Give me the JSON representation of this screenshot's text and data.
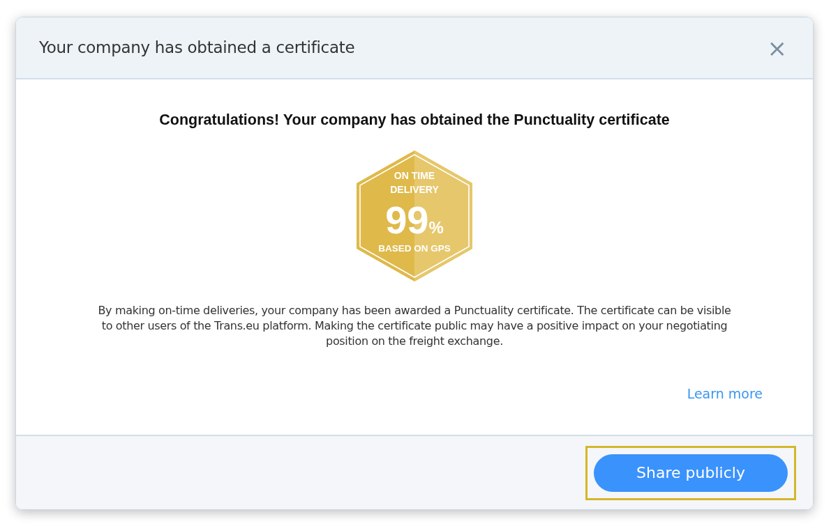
{
  "dialog": {
    "title": "Your company has obtained a certificate",
    "close": "×"
  },
  "heading": "Congratulations! Your company has obtained the Punctuality certificate",
  "badge": {
    "line_1": "ON TIME",
    "line_2": "DELIVERY",
    "value": "99",
    "unit": "%",
    "caption": "BASED ON GPS"
  },
  "description": "By making on-time deliveries, your company has been awarded a Punctuality certificate. The certificate can be visible to other users of the Trans.eu platform. Making the certificate public may have a positive impact on your negotiating position on the freight exchange.",
  "learn_more": "Learn more",
  "primary_button": {
    "label": "Share publicly",
    "highlighted": true
  }
}
